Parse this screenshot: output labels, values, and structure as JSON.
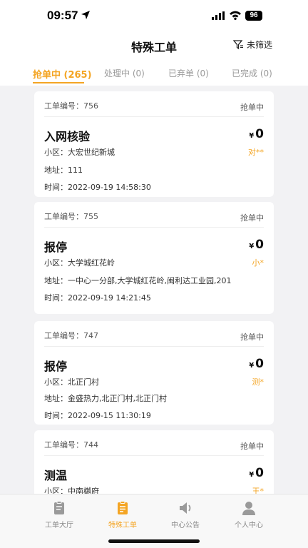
{
  "status_bar": {
    "time": "09:57",
    "battery": "96"
  },
  "header": {
    "title": "特殊工单",
    "filter_label": "未筛选"
  },
  "tabs": [
    {
      "label": "抢单中 (265)",
      "active": true
    },
    {
      "label": "处理中 (0)",
      "active": false
    },
    {
      "label": "已弃单 (0)",
      "active": false
    },
    {
      "label": "已完成 (0)",
      "active": false
    }
  ],
  "orders": [
    {
      "number": "工单编号：756",
      "status": "抢单中",
      "title": "入网核验",
      "currency": "¥",
      "amount": "0",
      "district": "小区：大宏世纪新城",
      "masked_name": "对**",
      "address": "地址：111",
      "time": "时间：2022-09-19 14:58:30"
    },
    {
      "number": "工单编号：755",
      "status": "抢单中",
      "title": "报停",
      "currency": "¥",
      "amount": "0",
      "district": "小区：大学城红花岭",
      "masked_name": "小*",
      "address": "地址：一中心一分部,大学城红花岭,闽利达工业园,201",
      "time": "时间：2022-09-19 14:21:45"
    },
    {
      "number": "工单编号：747",
      "status": "抢单中",
      "title": "报停",
      "currency": "¥",
      "amount": "0",
      "district": "小区：北正门村",
      "masked_name": "测*",
      "address": "地址：金盛热力,北正门村,北正门村",
      "time": "时间：2022-09-15 11:30:19"
    },
    {
      "number": "工单编号：744",
      "status": "抢单中",
      "title": "测温",
      "currency": "¥",
      "amount": "0",
      "district": "小区：中南樾府",
      "masked_name": "王*"
    }
  ],
  "bottom_nav": [
    {
      "label": "工单大厅",
      "icon": "clipboard-icon",
      "active": false
    },
    {
      "label": "特殊工单",
      "icon": "clipboard-list-icon",
      "active": true
    },
    {
      "label": "中心公告",
      "icon": "speaker-icon",
      "active": false
    },
    {
      "label": "个人中心",
      "icon": "person-icon",
      "active": false
    }
  ],
  "colors": {
    "accent": "#f4a524",
    "inactive": "#888888"
  }
}
